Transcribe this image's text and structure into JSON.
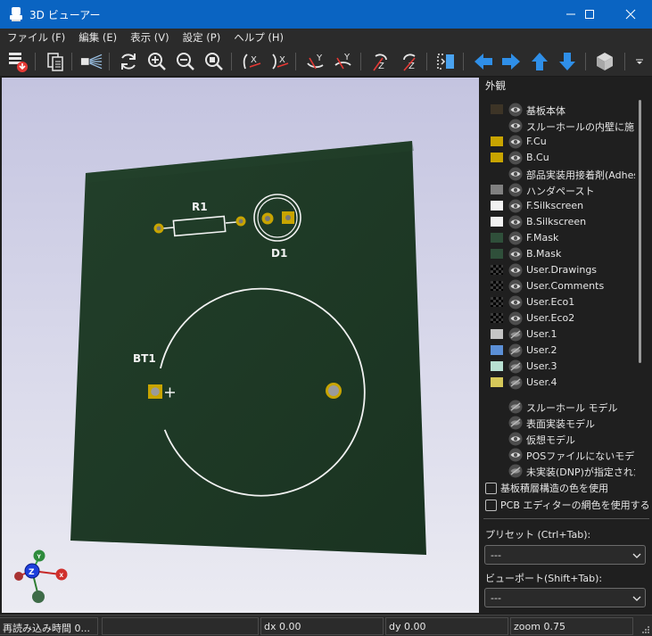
{
  "window": {
    "title": "3D ビューアー",
    "minimize_icon": "minimize-icon",
    "maximize_icon": "maximize-icon",
    "close_icon": "close-icon"
  },
  "menu": [
    "ファイル (F)",
    "編集 (E)",
    "表示 (V)",
    "設定 (P)",
    "ヘルプ (H)"
  ],
  "toolbar_icons": [
    "export-image-icon",
    "copy-clipboard-icon",
    "raytrace-icon",
    "reload-icon",
    "zoom-in-icon",
    "zoom-out-icon",
    "zoom-fit-icon",
    "rotate-x-cw-icon",
    "rotate-x-ccw-icon",
    "rotate-y-cw-icon",
    "rotate-y-ccw-icon",
    "rotate-z-cw-icon",
    "rotate-z-ccw-icon",
    "flip-board-icon",
    "pan-left-icon",
    "pan-right-icon",
    "pan-up-icon",
    "pan-down-icon",
    "ortho-view-icon",
    "toolbar-overflow-icon"
  ],
  "board": {
    "color": "#1f3a26",
    "silkscreen_color": "#f2f2f2",
    "pad_color": "#c8a400",
    "labels": {
      "r1": "R1",
      "d1": "D1",
      "bt1": "BT1",
      "plus": "+"
    }
  },
  "axes": {
    "z": "Z",
    "y": "Y",
    "x": "X"
  },
  "panel": {
    "title": "外観",
    "layers": [
      {
        "label": "基板本体",
        "color": "#3d3426",
        "eye": "eye-icon"
      },
      {
        "label": "スルーホールの内壁に施され",
        "color": "",
        "eye": "eye-icon"
      },
      {
        "label": "F.Cu",
        "color": "#c8a400",
        "eye": "eye-icon"
      },
      {
        "label": "B.Cu",
        "color": "#c8a400",
        "eye": "eye-icon"
      },
      {
        "label": "部品実装用接着剤(Adhesive)",
        "color": "",
        "eye": "eye-icon"
      },
      {
        "label": "ハンダペースト",
        "color": "#808080",
        "eye": "eye-icon"
      },
      {
        "label": "F.Silkscreen",
        "color": "#f2f2f2",
        "eye": "eye-icon"
      },
      {
        "label": "B.Silkscreen",
        "color": "#f2f2f2",
        "eye": "eye-icon"
      },
      {
        "label": "F.Mask",
        "color": "#2f4f3a",
        "eye": "eye-icon"
      },
      {
        "label": "B.Mask",
        "color": "#2f4f3a",
        "eye": "eye-icon"
      },
      {
        "label": "User.Drawings",
        "color": "checker",
        "eye": "eye-icon"
      },
      {
        "label": "User.Comments",
        "color": "checker",
        "eye": "eye-icon"
      },
      {
        "label": "User.Eco1",
        "color": "checker",
        "eye": "eye-icon"
      },
      {
        "label": "User.Eco2",
        "color": "checker",
        "eye": "eye-icon"
      },
      {
        "label": "User.1",
        "color": "#c4c4c4",
        "eye": "eye-hidden-icon"
      },
      {
        "label": "User.2",
        "color": "#5b8fd6",
        "eye": "eye-hidden-icon"
      },
      {
        "label": "User.3",
        "color": "#b8e0d2",
        "eye": "eye-hidden-icon"
      },
      {
        "label": "User.4",
        "color": "#d6c85a",
        "eye": "eye-hidden-icon"
      }
    ],
    "models": [
      {
        "label": "スルーホール モデル",
        "eye": "eye-hidden-icon"
      },
      {
        "label": "表面実装モデル",
        "eye": "eye-hidden-icon"
      },
      {
        "label": "仮想モデル",
        "eye": "eye-icon"
      },
      {
        "label": "POSファイルにないモデル",
        "eye": "eye-icon"
      },
      {
        "label": "未実装(DNP)が指定された",
        "eye": "eye-hidden-icon"
      }
    ],
    "checkbox_stackup": "基板積層構造の色を使用",
    "checkbox_pcb_colors": "PCB エディターの網色を使用する",
    "preset_label": "プリセット (Ctrl+Tab):",
    "preset_value": "---",
    "viewport_label": "ビューポート(Shift+Tab):",
    "viewport_value": "---"
  },
  "status": {
    "reload_time": "再読み込み時間 0...",
    "empty": "",
    "dx": "dx 0.00",
    "dy": "dy 0.00",
    "zoom": "zoom 0.75"
  }
}
